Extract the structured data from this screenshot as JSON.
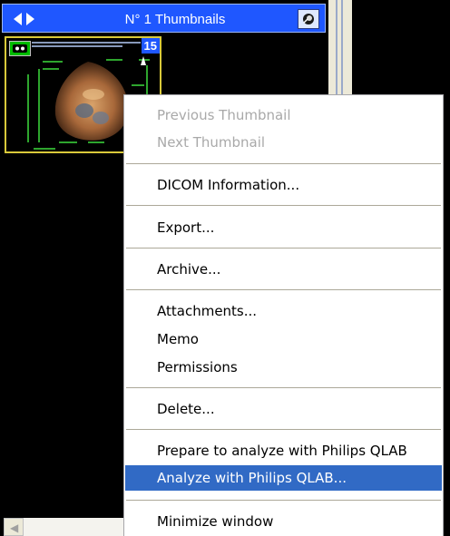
{
  "panel": {
    "title": "N° 1 Thumbnails",
    "thumbnail_count": "15"
  },
  "menu": {
    "items": [
      {
        "label": "Previous Thumbnail",
        "disabled": true
      },
      {
        "label": "Next Thumbnail",
        "disabled": true
      },
      {
        "label": "DICOM Information..."
      },
      {
        "label": "Export..."
      },
      {
        "label": "Archive..."
      },
      {
        "label": "Attachments..."
      },
      {
        "label": "Memo"
      },
      {
        "label": "Permissions"
      },
      {
        "label": "Delete..."
      },
      {
        "label": "Prepare to analyze with Philips QLAB"
      },
      {
        "label": "Analyze with Philips QLAB...",
        "selected": true
      },
      {
        "label": "Minimize window"
      }
    ]
  },
  "colors": {
    "title_bar": "#1f57ff",
    "menu_highlight": "#316ac5",
    "thumbnail_border": "#d9c93a"
  },
  "icons": [
    "arrow-left-icon",
    "arrow-right-icon",
    "settings-icon",
    "scroll-left-icon",
    "ultrasound-probe-icon"
  ]
}
